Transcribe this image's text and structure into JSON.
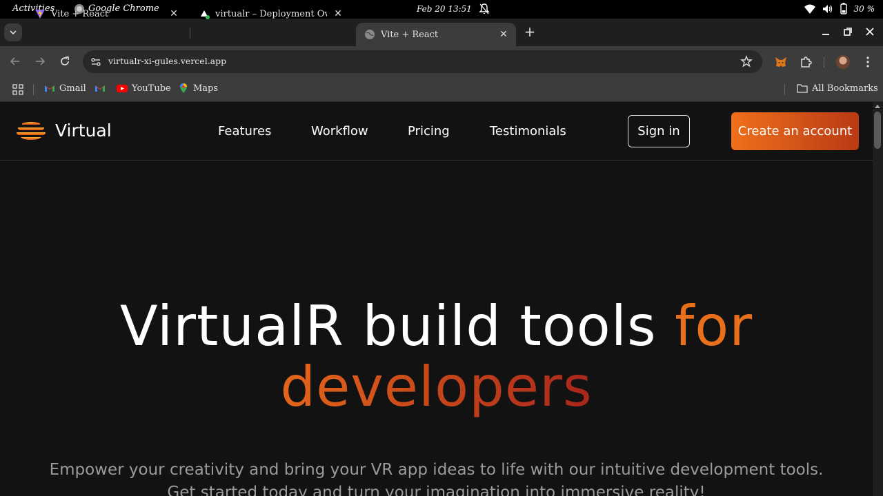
{
  "system_bar": {
    "activities": "Activities",
    "app_name": "Google Chrome",
    "clock": "Feb 20  13:51",
    "battery": "30 %"
  },
  "tabs": [
    {
      "title": "Vite + React",
      "active": false
    },
    {
      "title": "virtualr – Deployment Overv",
      "active": false
    },
    {
      "title": "Vite + React",
      "active": true
    }
  ],
  "address_bar": {
    "url": "virtualr-xi-gules.vercel.app"
  },
  "bookmarks": {
    "items": [
      "Gmail",
      "YouTube",
      "Maps"
    ],
    "all": "All Bookmarks"
  },
  "site": {
    "brand": "Virtual",
    "nav": [
      "Features",
      "Workflow",
      "Pricing",
      "Testimonials"
    ],
    "sign_in": "Sign in",
    "create_account": "Create an account",
    "hero": {
      "part1": "VirtualR build tools ",
      "part2": "for",
      "part3": "developers"
    },
    "subtitle_line1": "Empower your creativity and bring your VR app ideas to life with our intuitive development tools.",
    "subtitle_line2": "Get started today and turn your imagination into immersive reality!"
  },
  "colors": {
    "accent": "#f0701c",
    "accent_dark": "#b93a14",
    "page_bg": "#121212"
  }
}
